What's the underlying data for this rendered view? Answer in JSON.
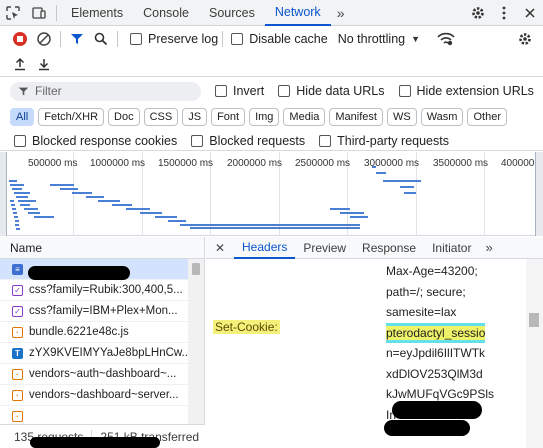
{
  "topbar": {
    "tabs": [
      "Elements",
      "Console",
      "Sources",
      "Network"
    ],
    "active_tab": "Network",
    "more": "»"
  },
  "toolbar": {
    "preserve_log": "Preserve log",
    "disable_cache": "Disable cache",
    "throttling": "No throttling"
  },
  "filter": {
    "placeholder": "Filter",
    "invert": "Invert",
    "hide_data_urls": "Hide data URLs",
    "hide_extension_urls": "Hide extension URLs"
  },
  "chips": [
    "All",
    "Fetch/XHR",
    "Doc",
    "CSS",
    "JS",
    "Font",
    "Img",
    "Media",
    "Manifest",
    "WS",
    "Wasm",
    "Other"
  ],
  "active_chip": "All",
  "blocked": {
    "blocked_cookies": "Blocked response cookies",
    "blocked_requests": "Blocked requests",
    "third_party": "Third-party requests"
  },
  "overview": {
    "labels": [
      "500000 ms",
      "1000000 ms",
      "1500000 ms",
      "2000000 ms",
      "2500000 ms",
      "3000000 ms",
      "3500000 ms",
      "400000"
    ]
  },
  "requests": {
    "header": "Name",
    "rows": [
      {
        "name": "",
        "type": "doc"
      },
      {
        "name": "css?family=Rubik:300,400,5...",
        "type": "css"
      },
      {
        "name": "css?family=IBM+Plex+Mon...",
        "type": "css"
      },
      {
        "name": "bundle.6221e48c.js",
        "type": "js"
      },
      {
        "name": "zYX9KVEIMYYaJe8bpLHnCw...",
        "type": "font"
      },
      {
        "name": "vendors~auth~dashboard~...",
        "type": "js"
      },
      {
        "name": "vendors~dashboard~server...",
        "type": "js"
      },
      {
        "name": "",
        "type": "js"
      }
    ],
    "count": "135 requests",
    "transferred": "251 kB transferred"
  },
  "detail": {
    "close": "✕",
    "tabs": [
      "Headers",
      "Preview",
      "Response",
      "Initiator"
    ],
    "active_tab": "Headers",
    "more": "»",
    "header_name": "Set-Cookie:",
    "value_lines": [
      "Max-Age=43200;",
      "path=/; secure;",
      "samesite=lax",
      "pterodactyl_sessio",
      "n=eyJpdil6IlITWTk",
      "xdDlOV253QlM3d",
      "kJwMUFqVGc9PSls",
      "In",
      ""
    ]
  },
  "colors": {
    "accent": "#0b57d0",
    "record_red": "#d93025",
    "chip_active_bg": "#c6dbfc",
    "highlight_yellow": "#eef268",
    "highlight_cyan": "#63e0e8"
  }
}
